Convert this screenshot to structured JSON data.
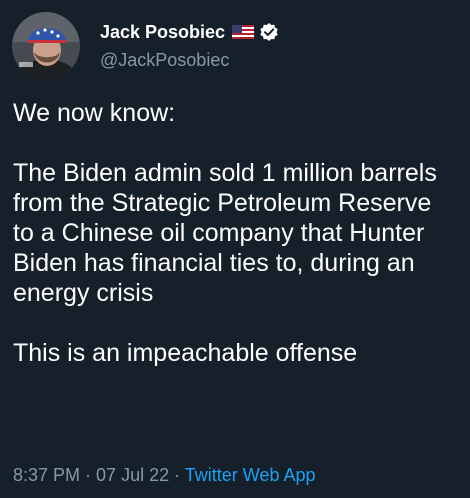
{
  "tweet": {
    "author": {
      "display_name": "Jack Posobiec",
      "handle": "@JackPosobiec",
      "flag_icon": "us-flag-icon",
      "verified_icon": "verified-badge-icon"
    },
    "paragraphs": [
      "We now know:",
      "The Biden admin sold 1 million barrels from the Strategic Petroleum Reserve to a Chinese oil company that Hunter Biden has financial ties to, during an energy crisis",
      "This is an impeachable offense"
    ],
    "meta": {
      "time": "8:37 PM",
      "separator": " · ",
      "date": "07 Jul 22",
      "source": "Twitter Web App"
    }
  },
  "colors": {
    "background": "#15202b",
    "text": "#ffffff",
    "secondary": "#8899a6",
    "accent": "#1da1f2"
  }
}
